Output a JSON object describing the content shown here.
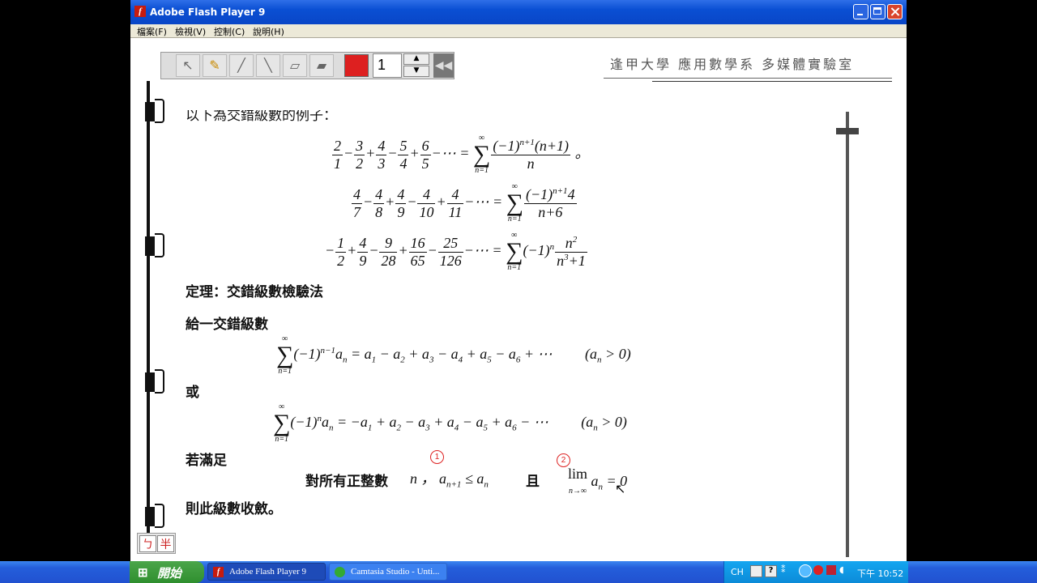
{
  "window": {
    "title": "Adobe Flash Player 9",
    "app_icon": "f"
  },
  "menubar": [
    "檔案(F)",
    "檢視(V)",
    "控制(C)",
    "說明(H)"
  ],
  "toolbar": {
    "page_value": "1",
    "color": "#dd2020",
    "tools": [
      "arrow-tool-icon",
      "pencil-tool-icon",
      "highlighter-tool-icon",
      "line-tool-icon",
      "eraser-tool-icon",
      "clear-eraser-tool-icon"
    ]
  },
  "header": {
    "title": "逢甲大學  應用數學系  多媒體實驗室"
  },
  "content": {
    "intro": "以下為交錯級數的例子：",
    "theorem": "定理：交錯級數檢驗法",
    "given": "給一交錯級數",
    "or": "或",
    "if": "若滿足",
    "condition_text": "對所有正整數",
    "and": "且",
    "conclusion": "則此級數收斂。",
    "circle1": "1",
    "circle2": "2"
  },
  "corner_buttons": [
    "ㄅ",
    "半"
  ],
  "taskbar": {
    "start": "開始",
    "tasks": [
      "Adobe Flash Player 9",
      "Camtasia Studio - Unti..."
    ],
    "lang": "CH",
    "clock": "下午 10:52"
  }
}
